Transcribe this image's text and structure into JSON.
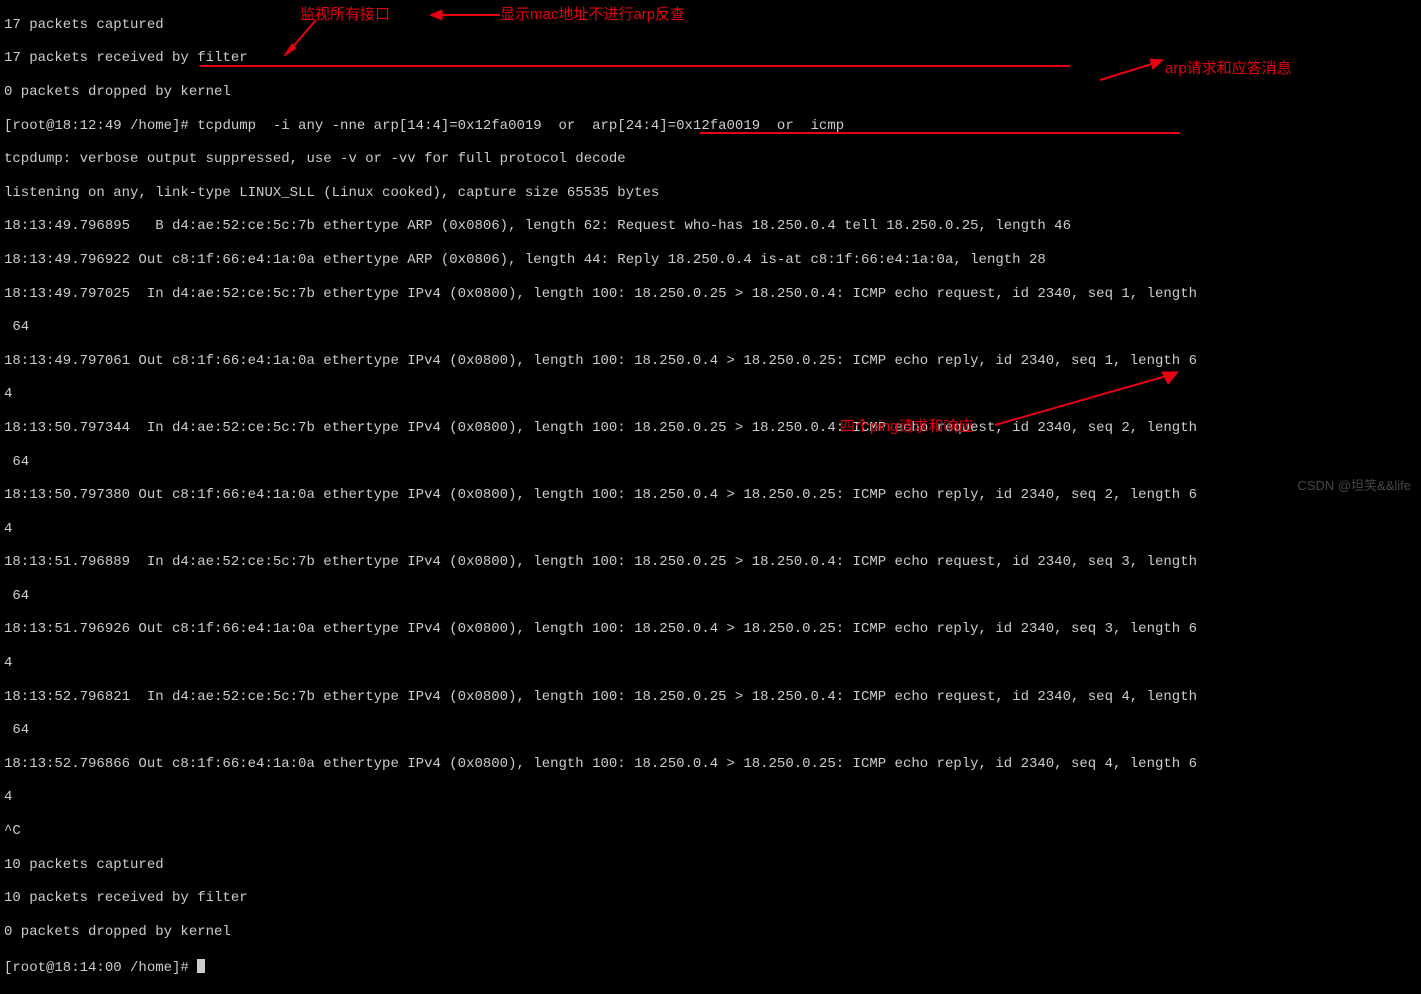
{
  "terminal": {
    "pre_lines": [
      "17 packets captured",
      "17 packets received by filter",
      "0 packets dropped by kernel"
    ],
    "prompt1_user": "[root@18:12:49 /home]# ",
    "command": "tcpdump  -i any -nne arp[14:4]=0x12fa0019  or  arp[24:4]=0x12fa0019  or  icmp",
    "capture_lines": [
      "tcpdump: verbose output suppressed, use -v or -vv for full protocol decode",
      "listening on any, link-type LINUX_SLL (Linux cooked), capture size 65535 bytes",
      "18:13:49.796895   B d4:ae:52:ce:5c:7b ethertype ARP (0x0806), length 62: Request who-has 18.250.0.4 tell 18.250.0.25, length 46",
      "18:13:49.796922 Out c8:1f:66:e4:1a:0a ethertype ARP (0x0806), length 44: Reply 18.250.0.4 is-at c8:1f:66:e4:1a:0a, length 28",
      "18:13:49.797025  In d4:ae:52:ce:5c:7b ethertype IPv4 (0x0800), length 100: 18.250.0.25 > 18.250.0.4: ICMP echo request, id 2340, seq 1, length",
      " 64",
      "18:13:49.797061 Out c8:1f:66:e4:1a:0a ethertype IPv4 (0x0800), length 100: 18.250.0.4 > 18.250.0.25: ICMP echo reply, id 2340, seq 1, length 6",
      "4",
      "18:13:50.797344  In d4:ae:52:ce:5c:7b ethertype IPv4 (0x0800), length 100: 18.250.0.25 > 18.250.0.4: ICMP echo request, id 2340, seq 2, length",
      " 64",
      "18:13:50.797380 Out c8:1f:66:e4:1a:0a ethertype IPv4 (0x0800), length 100: 18.250.0.4 > 18.250.0.25: ICMP echo reply, id 2340, seq 2, length 6",
      "4",
      "18:13:51.796889  In d4:ae:52:ce:5c:7b ethertype IPv4 (0x0800), length 100: 18.250.0.25 > 18.250.0.4: ICMP echo request, id 2340, seq 3, length",
      " 64",
      "18:13:51.796926 Out c8:1f:66:e4:1a:0a ethertype IPv4 (0x0800), length 100: 18.250.0.4 > 18.250.0.25: ICMP echo reply, id 2340, seq 3, length 6",
      "4",
      "18:13:52.796821  In d4:ae:52:ce:5c:7b ethertype IPv4 (0x0800), length 100: 18.250.0.25 > 18.250.0.4: ICMP echo request, id 2340, seq 4, length",
      " 64",
      "18:13:52.796866 Out c8:1f:66:e4:1a:0a ethertype IPv4 (0x0800), length 100: 18.250.0.4 > 18.250.0.25: ICMP echo reply, id 2340, seq 4, length 6",
      "4",
      "^C",
      "10 packets captured",
      "10 packets received by filter",
      "0 packets dropped by kernel"
    ],
    "prompt2_user": "[root@18:14:00 /home]# "
  },
  "annotations": {
    "a1": "监视所有接口",
    "a2": "显示mac地址不进行arp反查",
    "a3": "arp请求和应答消息",
    "a4": "四个ping请求和响应"
  },
  "watermark": "CSDN @坦笑&&life"
}
